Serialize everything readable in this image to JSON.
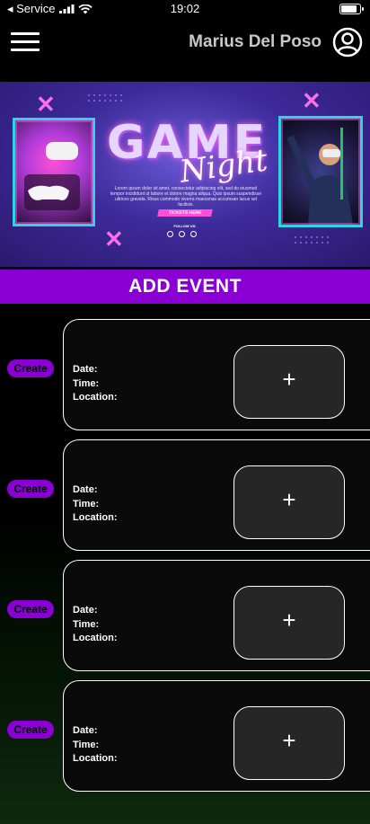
{
  "status_bar": {
    "carrier": "◂ Service",
    "time": "19:02"
  },
  "header": {
    "username": "Marius Del Poso",
    "menu_icon": "hamburger-icon",
    "profile_icon": "user-circle-icon"
  },
  "banner": {
    "title": "GAME",
    "subtitle": "Night",
    "body": "Lorem ipsum dolor sit amet, consectetur adipiscing elit, sed do eiusmod tempor incididunt ut labore et dolore magna aliqua. Quis ipsum suspendisse ultrices gravida. Risus commodo viverra maecenas accumsan lacus vel facilisis.",
    "tickets_label": "TICKETS HERE",
    "follow_label": "FOLLOW US:"
  },
  "add_event_label": "ADD EVENT",
  "events": [
    {
      "create_label": "Create",
      "date_label": "Date:",
      "time_label": "Time:",
      "location_label": "Location:",
      "add_symbol": "+"
    },
    {
      "create_label": "Create",
      "date_label": "Date:",
      "time_label": "Time:",
      "location_label": "Location:",
      "add_symbol": "+"
    },
    {
      "create_label": "Create",
      "date_label": "Date:",
      "time_label": "Time:",
      "location_label": "Location:",
      "add_symbol": "+"
    },
    {
      "create_label": "Create",
      "date_label": "Date:",
      "time_label": "Time:",
      "location_label": "Location:",
      "add_symbol": "+"
    }
  ],
  "colors": {
    "accent": "#8a00d4",
    "neon_pink": "#ff4fd6",
    "neon_cyan": "#2fd3e6"
  }
}
